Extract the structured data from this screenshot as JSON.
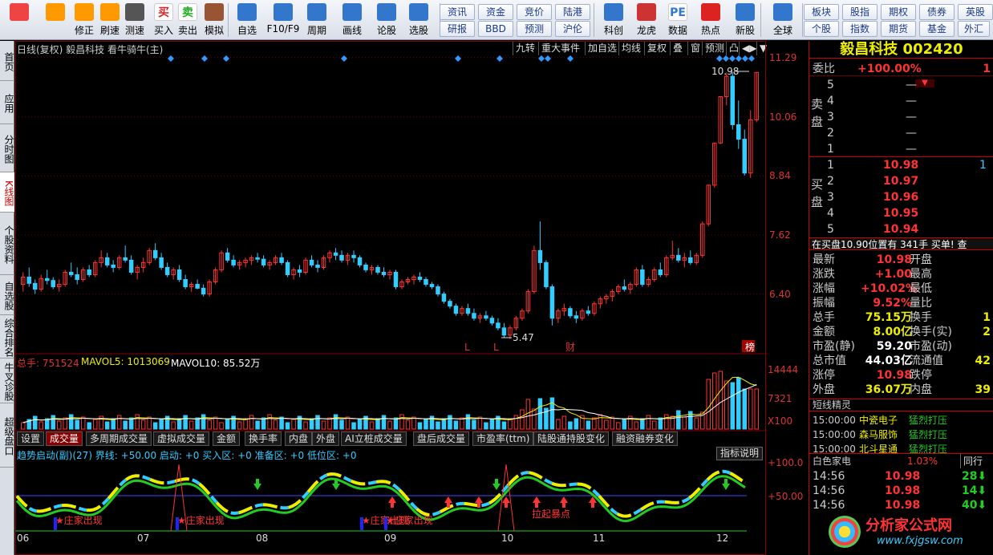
{
  "toolbar": {
    "big_buttons": [
      {
        "label": "",
        "icon": "grid-icon"
      },
      {
        "label": "",
        "icon": "back-arrow-icon"
      },
      {
        "label": "修正",
        "icon": "up-arrow-icon"
      },
      {
        "label": "刷速",
        "icon": "refresh-icon"
      },
      {
        "label": "测速",
        "icon": "clock-icon"
      },
      {
        "label": "买入",
        "icon": "buy-icon",
        "glyph": "买"
      },
      {
        "label": "卖出",
        "icon": "sell-icon",
        "glyph": "卖"
      },
      {
        "label": "模拟",
        "icon": "hammer-icon"
      },
      {
        "label": "自选",
        "icon": "watchlist-icon"
      },
      {
        "label": "F10/F9",
        "icon": "f10-icon"
      },
      {
        "label": "周期",
        "icon": "cycle-icon"
      },
      {
        "label": "画线",
        "icon": "pen-icon"
      },
      {
        "label": "论股",
        "icon": "discuss-icon"
      },
      {
        "label": "选股",
        "icon": "screen-icon"
      },
      {
        "label": "科创",
        "icon": "chart-icon"
      },
      {
        "label": "龙虎",
        "icon": "dragon-icon"
      },
      {
        "label": "数据",
        "icon": "pe-icon",
        "glyph": "PE"
      },
      {
        "label": "热点",
        "icon": "hot-icon"
      },
      {
        "label": "新股",
        "icon": "ipo-icon"
      },
      {
        "label": "全球",
        "icon": "globe-icon"
      }
    ],
    "small_buttons": [
      [
        "资讯",
        "资金",
        "竞价",
        "陆港"
      ],
      [
        "研报",
        "BBD",
        "预测",
        "沪伦"
      ],
      [
        "板块",
        "股指",
        "期权",
        "债券",
        "英股"
      ],
      [
        "个股",
        "指数",
        "期货",
        "基金",
        "外汇"
      ]
    ]
  },
  "leftnav": [
    "首页",
    "应用",
    "分时图",
    "K线图",
    "个股资料",
    "自选股",
    "综合排名",
    "牛叉诊股",
    "超级盘口"
  ],
  "chart": {
    "header": "日线(复权) 毅昌科技 看牛骑牛(主)",
    "header_buttons": [
      "九转",
      "重大事件",
      "加自选",
      "均线",
      "复权",
      "叠",
      "窗",
      "预测",
      "凸",
      "◀▶",
      "▼"
    ],
    "price_axis": [
      "11.29",
      "10.06",
      "8.84",
      "7.62",
      "6.40"
    ],
    "high_label": "10.98",
    "low_label": "5.47",
    "markers": [
      "L",
      "L",
      "财",
      "榜"
    ],
    "volume_header": {
      "total": "总手: 751524",
      "mavol5": "MAVOL5: 1013069",
      "mavol10": "MAVOL10: 85.52万"
    },
    "volume_axis": [
      "14444",
      "7321",
      "X100"
    ],
    "tabs": [
      "设置",
      "成交量",
      "多周期成交量",
      "虚拟成交量",
      "金额",
      "换手率",
      "内盘",
      "外盘",
      "AI立桩成交量",
      "盘后成交量",
      "市盈率(ttm)",
      "陆股通持股变化",
      "融资融券变化"
    ],
    "indicator_header": "趋势启动(副)(27) 界线: +50.00 启动: +0 买入区: +0 准备区: +0 低位区: +0",
    "indicator_button": "指标说明",
    "indicator_axis": [
      "+100.0",
      "+50.00"
    ],
    "indicator_labels": [
      "★庄家出现",
      "★庄家出现",
      "★庄家出现",
      "★庄家出现",
      "拉起暴点"
    ],
    "months": [
      "06",
      "07",
      "08",
      "09",
      "10",
      "11",
      "12"
    ]
  },
  "chart_data": {
    "type": "candlestick",
    "title": "日线(复权) 毅昌科技",
    "ylim": [
      5.2,
      11.3
    ],
    "ohlc": [
      [
        6.6,
        6.85,
        6.45,
        6.75
      ],
      [
        6.75,
        6.95,
        6.55,
        6.62
      ],
      [
        6.62,
        6.7,
        6.4,
        6.5
      ],
      [
        6.5,
        6.8,
        6.45,
        6.72
      ],
      [
        6.72,
        6.9,
        6.6,
        6.68
      ],
      [
        6.68,
        6.75,
        6.5,
        6.55
      ],
      [
        6.55,
        6.7,
        6.45,
        6.6
      ],
      [
        6.6,
        6.9,
        6.55,
        6.85
      ],
      [
        6.85,
        7.05,
        6.75,
        6.8
      ],
      [
        6.8,
        6.95,
        6.6,
        6.7
      ],
      [
        6.7,
        6.95,
        6.65,
        6.9
      ],
      [
        6.9,
        7.0,
        6.75,
        6.8
      ],
      [
        6.8,
        7.1,
        6.75,
        7.05
      ],
      [
        7.05,
        7.3,
        6.95,
        7.15
      ],
      [
        7.15,
        7.25,
        6.95,
        7.0
      ],
      [
        7.0,
        7.1,
        6.85,
        6.95
      ],
      [
        6.95,
        7.2,
        6.9,
        7.15
      ],
      [
        7.15,
        7.4,
        7.05,
        7.1
      ],
      [
        7.1,
        7.2,
        6.8,
        6.85
      ],
      [
        6.85,
        7.0,
        6.7,
        6.95
      ],
      [
        6.95,
        7.15,
        6.85,
        7.05
      ],
      [
        7.05,
        7.35,
        7.0,
        7.3
      ],
      [
        7.3,
        7.45,
        7.1,
        7.15
      ],
      [
        7.15,
        7.25,
        6.9,
        6.95
      ],
      [
        6.95,
        7.05,
        6.75,
        6.8
      ],
      [
        6.8,
        6.95,
        6.7,
        6.9
      ],
      [
        6.9,
        7.0,
        6.65,
        6.7
      ],
      [
        6.7,
        6.8,
        6.5,
        6.55
      ],
      [
        6.55,
        6.65,
        6.45,
        6.6
      ],
      [
        6.6,
        6.7,
        6.5,
        6.52
      ],
      [
        6.52,
        6.6,
        6.35,
        6.4
      ],
      [
        6.4,
        6.7,
        6.35,
        6.65
      ],
      [
        6.65,
        6.95,
        6.6,
        6.9
      ],
      [
        6.9,
        7.3,
        6.85,
        7.25
      ],
      [
        7.25,
        7.35,
        7.05,
        7.1
      ],
      [
        7.1,
        7.2,
        6.95,
        7.0
      ],
      [
        7.0,
        7.1,
        6.9,
        7.05
      ],
      [
        7.05,
        7.15,
        6.95,
        7.1
      ],
      [
        7.1,
        7.2,
        7.0,
        7.15
      ],
      [
        7.15,
        7.25,
        7.05,
        7.12
      ],
      [
        7.12,
        7.2,
        6.95,
        7.0
      ],
      [
        7.0,
        7.1,
        6.9,
        7.05
      ],
      [
        7.05,
        7.2,
        7.0,
        7.15
      ],
      [
        7.15,
        7.25,
        7.0,
        7.05
      ],
      [
        7.05,
        7.1,
        6.75,
        6.8
      ],
      [
        6.8,
        6.95,
        6.7,
        6.9
      ],
      [
        6.9,
        7.0,
        6.75,
        6.85
      ],
      [
        6.85,
        7.15,
        6.8,
        7.1
      ],
      [
        7.1,
        7.2,
        6.95,
        7.0
      ],
      [
        7.0,
        7.1,
        6.85,
        6.95
      ],
      [
        6.95,
        7.2,
        6.9,
        7.15
      ],
      [
        7.15,
        7.3,
        7.05,
        7.25
      ],
      [
        7.25,
        7.35,
        7.1,
        7.2
      ],
      [
        7.2,
        7.3,
        7.05,
        7.1
      ],
      [
        7.1,
        7.25,
        7.0,
        7.2
      ],
      [
        7.2,
        7.3,
        7.05,
        7.15
      ],
      [
        7.15,
        7.2,
        6.95,
        7.0
      ],
      [
        7.0,
        7.05,
        6.85,
        6.9
      ],
      [
        6.9,
        7.0,
        6.8,
        6.95
      ],
      [
        6.95,
        7.0,
        6.8,
        6.85
      ],
      [
        6.85,
        6.95,
        6.75,
        6.8
      ],
      [
        6.8,
        6.9,
        6.7,
        6.85
      ],
      [
        6.85,
        6.9,
        6.5,
        6.55
      ],
      [
        6.55,
        6.7,
        6.5,
        6.65
      ],
      [
        6.65,
        6.75,
        6.6,
        6.7
      ],
      [
        6.7,
        6.8,
        6.6,
        6.75
      ],
      [
        6.75,
        6.85,
        6.65,
        6.7
      ],
      [
        6.7,
        6.75,
        6.55,
        6.6
      ],
      [
        6.6,
        6.65,
        6.5,
        6.55
      ],
      [
        6.55,
        6.6,
        6.35,
        6.4
      ],
      [
        6.4,
        6.45,
        6.2,
        6.25
      ],
      [
        6.25,
        6.3,
        6.1,
        6.15
      ],
      [
        6.15,
        6.2,
        5.95,
        6.0
      ],
      [
        6.0,
        6.15,
        5.95,
        6.1
      ],
      [
        6.1,
        6.2,
        5.95,
        6.0
      ],
      [
        6.0,
        6.1,
        5.85,
        5.9
      ],
      [
        5.9,
        6.0,
        5.8,
        5.95
      ],
      [
        5.95,
        6.05,
        5.85,
        5.9
      ],
      [
        5.9,
        5.95,
        5.75,
        5.8
      ],
      [
        5.8,
        5.9,
        5.65,
        5.7
      ],
      [
        5.7,
        5.8,
        5.5,
        5.55
      ],
      [
        5.55,
        5.75,
        5.47,
        5.7
      ],
      [
        5.7,
        5.95,
        5.65,
        5.9
      ],
      [
        5.9,
        6.1,
        5.85,
        6.05
      ],
      [
        6.05,
        6.5,
        6.0,
        6.45
      ],
      [
        6.45,
        7.4,
        6.4,
        7.3
      ],
      [
        7.3,
        7.9,
        6.9,
        7.05
      ],
      [
        7.05,
        7.1,
        6.5,
        6.55
      ],
      [
        6.55,
        6.6,
        5.75,
        5.9
      ],
      [
        5.9,
        6.1,
        5.8,
        6.05
      ],
      [
        6.05,
        6.2,
        5.95,
        6.1
      ],
      [
        6.1,
        6.15,
        5.9,
        5.95
      ],
      [
        5.95,
        6.05,
        5.8,
        5.9
      ],
      [
        5.9,
        6.1,
        5.85,
        6.05
      ],
      [
        6.05,
        6.15,
        5.95,
        6.0
      ],
      [
        6.0,
        6.25,
        5.95,
        6.2
      ],
      [
        6.2,
        6.35,
        6.1,
        6.3
      ],
      [
        6.3,
        6.4,
        6.2,
        6.35
      ],
      [
        6.35,
        6.5,
        6.25,
        6.45
      ],
      [
        6.45,
        6.6,
        6.4,
        6.55
      ],
      [
        6.55,
        6.7,
        6.45,
        6.5
      ],
      [
        6.5,
        6.65,
        6.4,
        6.6
      ],
      [
        6.6,
        6.95,
        6.55,
        6.9
      ],
      [
        6.9,
        7.0,
        6.55,
        6.6
      ],
      [
        6.6,
        6.75,
        6.55,
        6.7
      ],
      [
        6.7,
        6.95,
        6.65,
        6.9
      ],
      [
        6.9,
        7.05,
        6.75,
        6.8
      ],
      [
        6.8,
        7.2,
        6.75,
        7.15
      ],
      [
        7.15,
        7.5,
        7.1,
        7.2
      ],
      [
        7.2,
        7.35,
        7.05,
        7.1
      ],
      [
        7.1,
        7.25,
        6.95,
        7.15
      ],
      [
        7.15,
        7.3,
        7.0,
        7.05
      ],
      [
        7.05,
        7.25,
        7.0,
        7.2
      ],
      [
        7.2,
        7.9,
        7.15,
        7.85
      ],
      [
        7.85,
        8.65,
        7.8,
        8.65
      ],
      [
        8.65,
        9.52,
        8.6,
        9.52
      ],
      [
        9.52,
        10.48,
        9.5,
        10.48
      ],
      [
        10.48,
        10.98,
        10.3,
        10.9
      ],
      [
        10.9,
        10.98,
        9.8,
        9.9
      ],
      [
        9.9,
        10.4,
        9.4,
        9.6
      ],
      [
        9.6,
        9.8,
        8.85,
        8.9
      ],
      [
        8.9,
        10.2,
        8.8,
        10.0
      ],
      [
        10.0,
        10.98,
        9.95,
        10.98
      ]
    ]
  },
  "rightpanel": {
    "title": "毅昌科技 002420",
    "weibi": {
      "label": "委比",
      "value": "+100.00%",
      "extra": "1"
    },
    "sell_label": "卖盘",
    "buy_label": "买盘",
    "sell_rows": [
      {
        "n": "5",
        "p": "—"
      },
      {
        "n": "4",
        "p": "—"
      },
      {
        "n": "3",
        "p": "—"
      },
      {
        "n": "2",
        "p": "—"
      },
      {
        "n": "1",
        "p": "—"
      }
    ],
    "buy_rows": [
      {
        "n": "1",
        "p": "10.98",
        "v": "1"
      },
      {
        "n": "2",
        "p": "10.97"
      },
      {
        "n": "3",
        "p": "10.96"
      },
      {
        "n": "4",
        "p": "10.95"
      },
      {
        "n": "5",
        "p": "10.94"
      }
    ],
    "buy_note": "在买盘10.90位置有  341手  买单!  查",
    "stats": [
      [
        "最新",
        "10.98",
        "开盘",
        ""
      ],
      [
        "涨跌",
        "+1.00",
        "最高",
        ""
      ],
      [
        "涨幅",
        "+10.02%",
        "最低",
        ""
      ],
      [
        "振幅",
        "9.52%",
        "量比",
        ""
      ],
      [
        "总手",
        "75.15万",
        "换手",
        "1"
      ],
      [
        "金额",
        "8.00亿",
        "换手(实)",
        "2"
      ],
      [
        "市盈(静)",
        "59.20",
        "市盈(动)",
        ""
      ],
      [
        "总市值",
        "44.03亿",
        "流通值",
        "42"
      ],
      [
        "涨停",
        "10.98",
        "跌停",
        ""
      ],
      [
        "外盘",
        "36.07万",
        "内盘",
        "39"
      ]
    ],
    "jingling_title": "短线精灵",
    "jingling": [
      [
        "15:00:00",
        "中瓷电子",
        "猛烈打压"
      ],
      [
        "15:00:00",
        "森马服饰",
        "猛烈打压"
      ],
      [
        "15:00:00",
        "北斗星通",
        "猛烈打压"
      ]
    ],
    "sector": {
      "name": "白色家电",
      "change": "1.03%",
      "tab": "同行"
    },
    "ticks": [
      [
        "14:56",
        "10.98",
        "28"
      ],
      [
        "14:56",
        "10.98",
        "14"
      ],
      [
        "14:56",
        "10.98",
        "40"
      ]
    ],
    "watermark_cn": "分析家公式网",
    "watermark_url": "www.fxjgsw.com"
  }
}
